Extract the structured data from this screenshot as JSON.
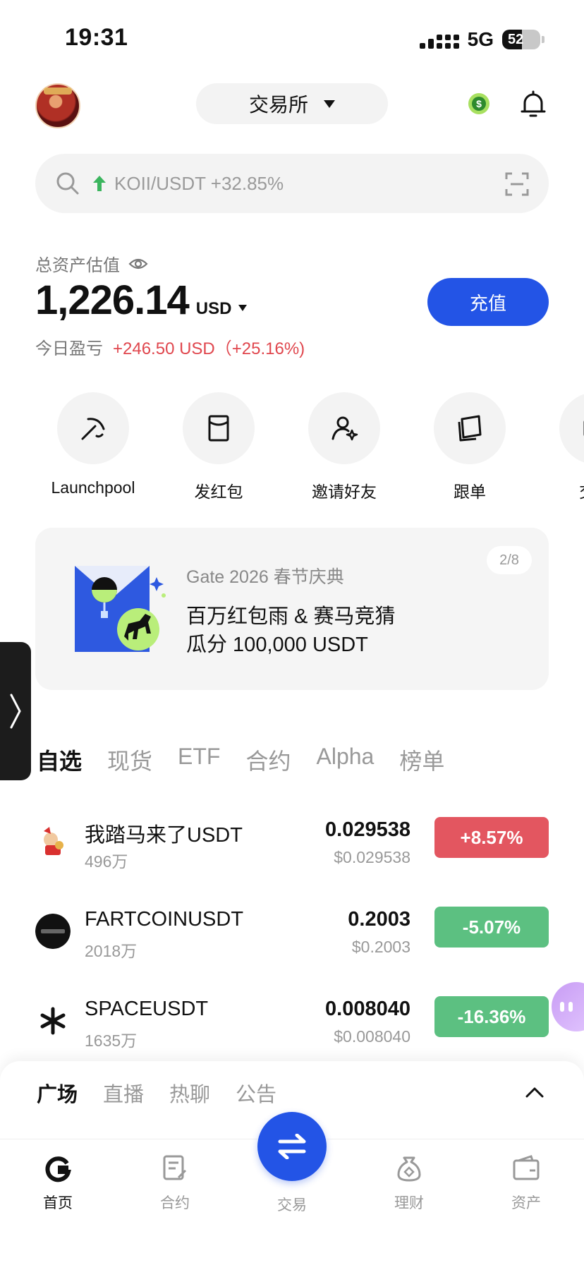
{
  "status_bar": {
    "time": "19:31",
    "network": "5G",
    "battery": "52"
  },
  "header": {
    "exchange_label": "交易所"
  },
  "search": {
    "placeholder": "KOII/USDT +32.85%"
  },
  "assets": {
    "label": "总资产估值",
    "value": "1,226.14",
    "currency": "USD",
    "pnl_label": "今日盈亏",
    "pnl_value": "+246.50 USD（+25.16%)",
    "deposit_label": "充值"
  },
  "quick_actions": [
    {
      "label": "Launchpool",
      "icon": "pickaxe-icon"
    },
    {
      "label": "发红包",
      "icon": "red-envelope-icon"
    },
    {
      "label": "邀请好友",
      "icon": "invite-user-icon"
    },
    {
      "label": "跟单",
      "icon": "copy-trade-icon"
    },
    {
      "label": "交易",
      "icon": "trade-icon"
    }
  ],
  "banner": {
    "subtitle": "Gate 2026 春节庆典",
    "line1": "百万红包雨 & 赛马竞猜",
    "line2": "瓜分 100,000 USDT",
    "pager": "2/8"
  },
  "market_tabs": [
    "自选",
    "现货",
    "ETF",
    "合约",
    "Alpha",
    "榜单"
  ],
  "market_rows": [
    {
      "name": "我踏马来了USDT",
      "volume": "496万",
      "price": "0.029538",
      "usd_price": "$0.029538",
      "change": "+8.57%",
      "direction": "up"
    },
    {
      "name": "FARTCOINUSDT",
      "volume": "2018万",
      "price": "0.2003",
      "usd_price": "$0.2003",
      "change": "-5.07%",
      "direction": "down"
    },
    {
      "name": "SPACEUSDT",
      "volume": "1635万",
      "price": "0.008040",
      "usd_price": "$0.008040",
      "change": "-16.36%",
      "direction": "down"
    }
  ],
  "community_tabs": [
    "广场",
    "直播",
    "热聊",
    "公告"
  ],
  "bottom_nav": [
    {
      "label": "首页",
      "icon": "home-icon"
    },
    {
      "label": "合约",
      "icon": "contract-icon"
    },
    {
      "label": "交易",
      "icon": "swap-icon"
    },
    {
      "label": "理财",
      "icon": "finance-icon"
    },
    {
      "label": "资产",
      "icon": "wallet-icon"
    }
  ],
  "colors": {
    "accent": "#2354e6",
    "up": "#e35660",
    "down": "#5cc081",
    "pnl": "#e0474e"
  }
}
